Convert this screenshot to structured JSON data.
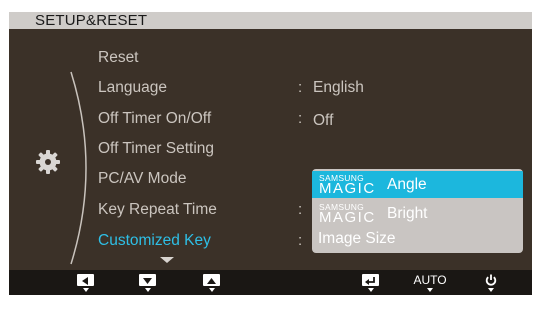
{
  "header": {
    "title": "SETUP&RESET"
  },
  "menu": {
    "items": [
      {
        "label": "Reset",
        "value": ""
      },
      {
        "label": "Language",
        "value": "English"
      },
      {
        "label": "Off Timer On/Off",
        "value": "Off"
      },
      {
        "label": "Off Timer Setting",
        "value": ""
      },
      {
        "label": "PC/AV Mode",
        "value": ""
      },
      {
        "label": "Key Repeat Time",
        "value": ""
      },
      {
        "label": "Customized Key",
        "value": ""
      }
    ],
    "selected_index": 6
  },
  "dropdown": {
    "options": [
      {
        "brand": "SAMSUNG",
        "magic": "MAGIC",
        "label": "Angle",
        "selected": true
      },
      {
        "brand": "SAMSUNG",
        "magic": "MAGIC",
        "label": "Bright",
        "selected": false
      },
      {
        "label": "Image Size",
        "selected": false
      }
    ]
  },
  "bottom_bar": {
    "buttons": [
      {
        "icon": "left-arrow-icon"
      },
      {
        "icon": "down-arrow-icon"
      },
      {
        "icon": "up-arrow-icon"
      },
      {
        "icon": "enter-icon"
      },
      {
        "icon": "auto",
        "label": "AUTO"
      },
      {
        "icon": "power-icon"
      }
    ]
  },
  "colors": {
    "background": "#3b3128",
    "selected_text": "#2ebfe6",
    "dropdown_active": "#1cb7dd",
    "dropdown_bg": "#c9c5c2"
  }
}
